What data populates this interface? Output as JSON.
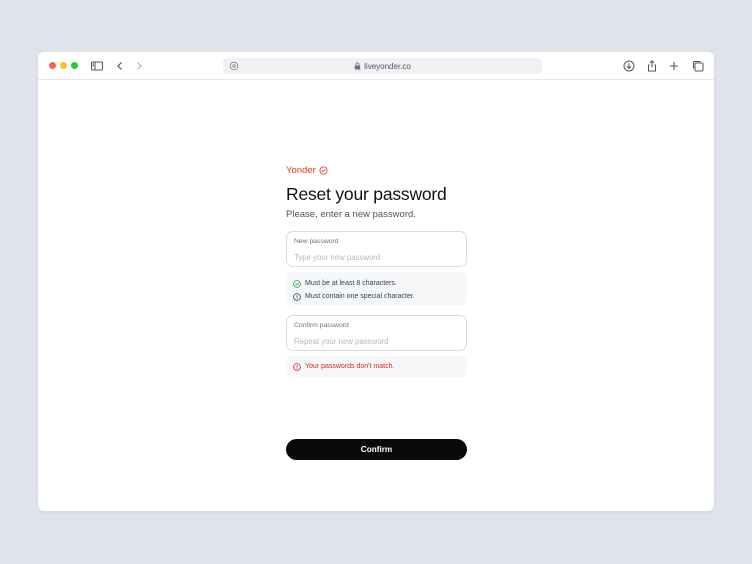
{
  "browser": {
    "url": "liveyonder.co"
  },
  "brand": {
    "name": "Yonder",
    "accent": "#e5341e"
  },
  "form": {
    "title": "Reset your password",
    "subtitle": "Please, enter a new password.",
    "new_password": {
      "label": "New password",
      "placeholder": "Type your new password",
      "value": ""
    },
    "requirements": [
      {
        "text": "Must be at least 8 characters.",
        "status": "met",
        "icon": "check-circle-icon"
      },
      {
        "text": "Must contain one special character.",
        "status": "pending",
        "icon": "info-circle-icon"
      }
    ],
    "confirm_password": {
      "label": "Confirm password",
      "placeholder": "Repeat your new password",
      "value": ""
    },
    "error": {
      "text": "Your passwords don't match.",
      "color": "#dc2626",
      "icon": "alert-circle-icon"
    },
    "submit_label": "Confirm"
  }
}
